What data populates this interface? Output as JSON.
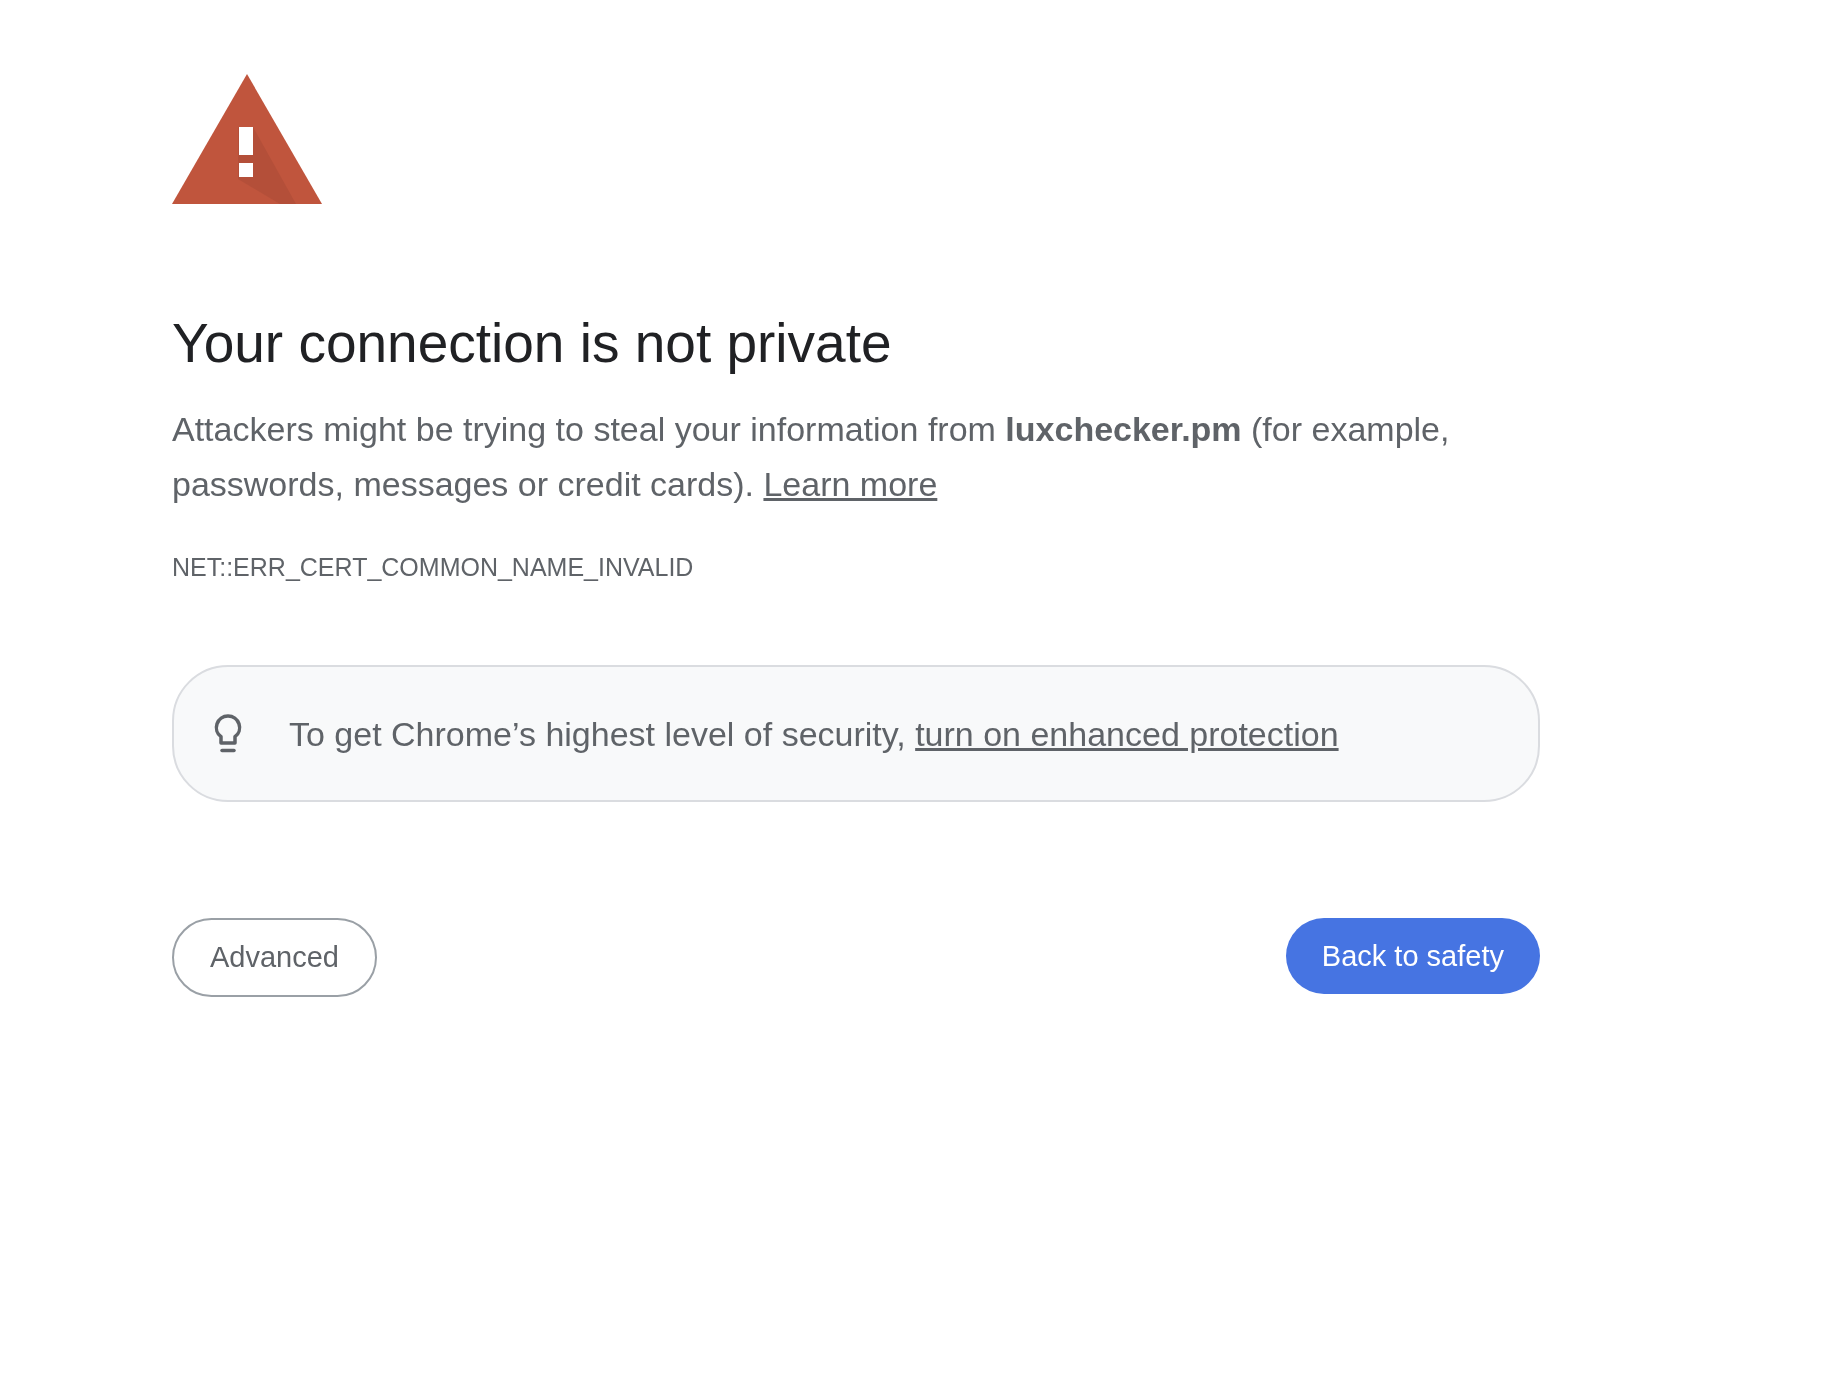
{
  "warning": {
    "heading": "Your connection is not private",
    "message": "Attackers might be trying to steal your information from **luxchecker.pm** (for example, passwords, messages or credit cards).",
    "learn_more_link": "Learn more",
    "error_code": "NET::ERR_CERT_COMMON_NAME_INVALID"
  },
  "tip": {
    "text": "To get Chrome’s highest level of security,",
    "link": "turn on enhanced protection"
  },
  "buttons": [
    {
      "label": "Advanced",
      "kind": "secondary"
    },
    {
      "label": "Back to safety",
      "kind": "primary"
    }
  ]
}
